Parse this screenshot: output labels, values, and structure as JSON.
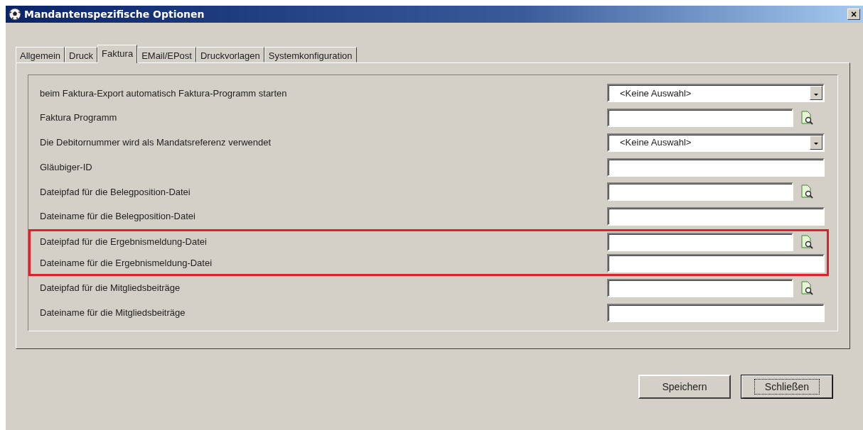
{
  "window": {
    "title": "Mandantenspezifische Optionen",
    "close": "×"
  },
  "tabs": [
    {
      "label": "Allgemein",
      "selected": false
    },
    {
      "label": "Druck",
      "selected": false
    },
    {
      "label": "Faktura",
      "selected": true
    },
    {
      "label": "EMail/EPost",
      "selected": false
    },
    {
      "label": "Druckvorlagen",
      "selected": false
    },
    {
      "label": "Systemkonfiguration",
      "selected": false
    }
  ],
  "rows": [
    {
      "label": "beim Faktura-Export automatisch Faktura-Programm starten",
      "kind": "dropdown",
      "value": "<Keine Auswahl>",
      "highlighted": false
    },
    {
      "label": "Faktura Programm",
      "kind": "browse",
      "highlighted": false
    },
    {
      "label": "Die Debitornummer wird als Mandatsreferenz verwendet",
      "kind": "dropdown",
      "value": "<Keine Auswahl>",
      "highlighted": false
    },
    {
      "label": "Gläubiger-ID",
      "kind": "text",
      "highlighted": false
    },
    {
      "label": "Dateipfad für die Belegposition-Datei",
      "kind": "browse",
      "highlighted": false
    },
    {
      "label": "Dateiname für die Belegposition-Datei",
      "kind": "text",
      "highlighted": false
    },
    {
      "label": "Dateipfad für die Ergebnismeldung-Datei",
      "kind": "browse",
      "highlighted": true
    },
    {
      "label": "Dateiname für die Ergebnismeldung-Datei",
      "kind": "text",
      "highlighted": true
    },
    {
      "label": "Dateipfad für die Mitgliedsbeiträge",
      "kind": "browse",
      "highlighted": false
    },
    {
      "label": "Dateiname für die Mitgliedsbeiträge",
      "kind": "text",
      "highlighted": false
    }
  ],
  "buttons": [
    {
      "label": "Speichern",
      "default": false
    },
    {
      "label": "Schließen",
      "default": true
    }
  ]
}
